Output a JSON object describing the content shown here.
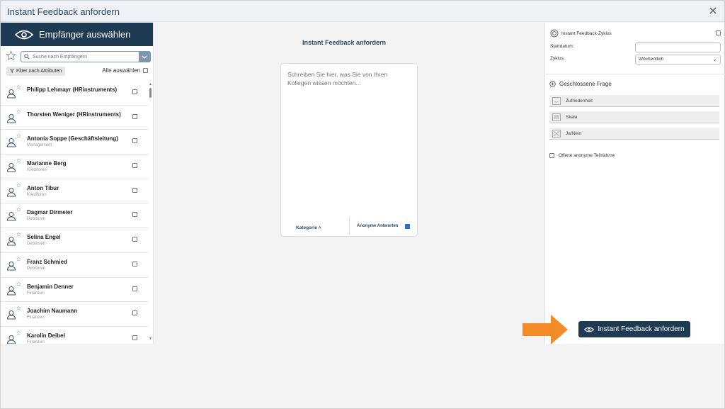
{
  "window": {
    "title": "Instant Feedback anfordern"
  },
  "left": {
    "header": "Empfänger auswählen",
    "search_placeholder": "Suche nach Empfängern",
    "filter_label": "Filter nach Attributen",
    "select_all_label": "Alle auswählen",
    "recipients": [
      {
        "name": "Philipp Lehmayr (HRinstruments)",
        "dept": ""
      },
      {
        "name": "Thorsten Weniger (HRinstruments)",
        "dept": ""
      },
      {
        "name": "Antonia Soppe (Geschäftsleitung)",
        "dept": "Management"
      },
      {
        "name": "Marianne Berg",
        "dept": "Kreditoren"
      },
      {
        "name": "Anton Tibur",
        "dept": "Kreditoren"
      },
      {
        "name": "Dagmar Dirmeier",
        "dept": "Debitoren"
      },
      {
        "name": "Selina Engel",
        "dept": "Debitoren"
      },
      {
        "name": "Franz Schmied",
        "dept": "Debitoren"
      },
      {
        "name": "Benjamin Denner",
        "dept": "Finanzen"
      },
      {
        "name": "Joachim Naumann",
        "dept": "Finanzen"
      },
      {
        "name": "Karolin Deibel",
        "dept": "Finanzen"
      }
    ]
  },
  "center": {
    "title": "Instant Feedback anfordern",
    "message_placeholder": "Schreiben Sie hier, was Sie von Ihren Kollegen wissen möchten...",
    "category_label": "Kategorie ˄",
    "anonymous_label": "Anonyme Antworten",
    "anonymous_checked": true
  },
  "right": {
    "cycle_label": "Instant Feedback-Zyklus",
    "start_date_label": "Startdatum:",
    "start_date_value": "",
    "cycle_select_label": "Zyklus:",
    "cycle_value": "Wöchentlich",
    "closed_question_label": "Geschlossene Frage",
    "options": [
      "Zufriedenheit",
      "Skala",
      "Ja/Nein"
    ],
    "open_anonymous_label": "Offene anonyme Teilnahme"
  },
  "submit_label": "Instant Feedback anfordern",
  "colors": {
    "primary": "#1f3b53",
    "accent_arrow": "#f28c28",
    "checkbox_active": "#2d6bd1"
  }
}
